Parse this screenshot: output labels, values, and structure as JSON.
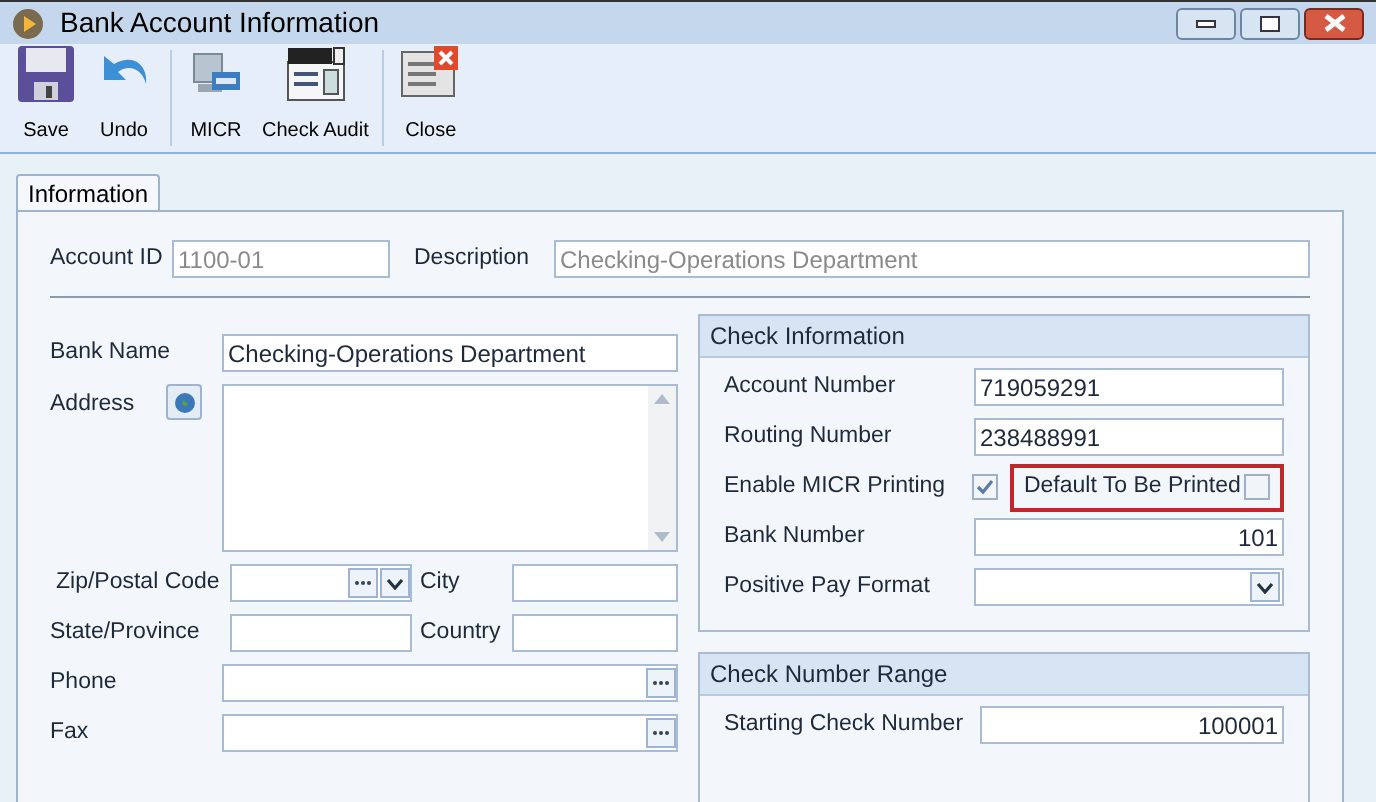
{
  "window": {
    "title": "Bank Account Information"
  },
  "toolbar": [
    {
      "label": "Save",
      "kind": "save"
    },
    {
      "label": "Undo",
      "kind": "undo"
    },
    {
      "label": "MICR",
      "kind": "micr"
    },
    {
      "label": "Check Audit",
      "kind": "audit"
    },
    {
      "label": "Close",
      "kind": "close"
    }
  ],
  "tabs": [
    {
      "label": "Information",
      "selected": true
    }
  ],
  "header": {
    "account_id_label": "Account ID",
    "account_id": "1100-01",
    "description_label": "Description",
    "description": "Checking-Operations Department"
  },
  "left": {
    "bank_name_label": "Bank Name",
    "bank_name": "Checking-Operations Department",
    "address_label": "Address",
    "zip_label": "Zip/Postal Code",
    "city_label": "City",
    "state_label": "State/Province",
    "country_label": "Country",
    "phone_label": "Phone",
    "fax_label": "Fax"
  },
  "check_information": {
    "title": "Check Information",
    "account_number_label": "Account Number",
    "account_number": "719059291",
    "routing_number_label": "Routing Number",
    "routing_number": "238488991",
    "micr_label": "Enable MICR Printing",
    "micr_checked": true,
    "default_label": "Default To Be Printed",
    "default_checked": false,
    "bank_number_label": "Bank Number",
    "bank_number": "101",
    "positive_pay_label": "Positive Pay Format"
  },
  "check_number_range": {
    "title": "Check Number Range",
    "starting_label": "Starting Check Number",
    "starting": "100001"
  }
}
